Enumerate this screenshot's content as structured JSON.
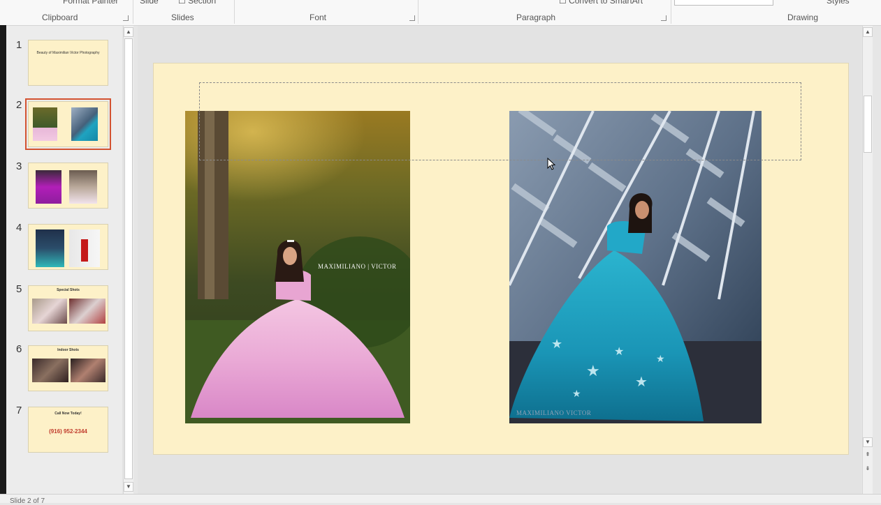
{
  "ribbon": {
    "group_labels": [
      "Clipboard",
      "Slides",
      "Font",
      "Paragraph",
      "Drawing"
    ],
    "fragments": {
      "format_painter": "Format Painter",
      "slide": "Slide",
      "section": "Section",
      "convert_smartart": "Convert to SmartArt",
      "styles": "Styles"
    }
  },
  "thumbnails": {
    "numbers": [
      "1",
      "2",
      "3",
      "4",
      "5",
      "6",
      "7"
    ],
    "slide1_text": "Beauty of Maximilian Victor Photography",
    "slide5_title": "Special Shots",
    "slide6_title": "Indoor Shots",
    "slide7_title": "Call Now Today!",
    "slide7_phone": "(916) 952-2344",
    "selected": "2"
  },
  "slide": {
    "watermark_left": "MAXIMILIANO | VICTOR",
    "watermark_right": "MAXIMILIANO VICTOR"
  },
  "status": {
    "left": "Slide 2 of 7",
    "accent": "#d35230"
  },
  "icons": [
    "scroll-up-icon",
    "scroll-down-icon",
    "prev-slide-icon",
    "next-slide-icon",
    "mouse-cursor-icon",
    "dialog-launcher-icon"
  ]
}
